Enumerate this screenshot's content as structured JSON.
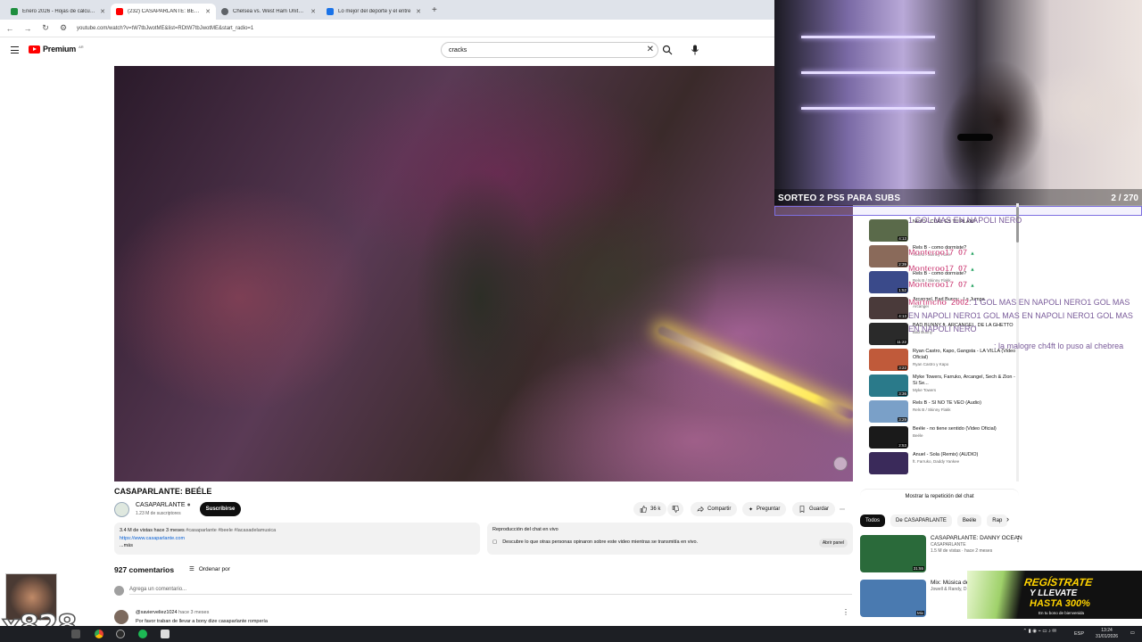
{
  "browser": {
    "tabs": [
      {
        "label": "Enero 2026 - Hojas de cálculo de Google",
        "color": "#1e8e3e"
      },
      {
        "label": "(232) CASAPARLANTE: BEÉLE",
        "color": "#ff0000",
        "active": true
      },
      {
        "label": "Chelsea vs. West Ham United |",
        "color": "#5f6368"
      },
      {
        "label": "Lo mejor del deporte y el entre",
        "color": "#1a73e8"
      }
    ],
    "url": "youtube.com/watch?v=tW7tbJwotME&list=RDtW7tbJwotME&start_radio=1"
  },
  "youtube": {
    "logo": "Premium",
    "logo_country": "AR",
    "search_value": "cracks"
  },
  "overlay": {
    "giveaway_title": "SORTEO 2 PS5 PARA SUBS",
    "giveaway_count": "2",
    "giveaway_total": "/ 270",
    "chat": [
      {
        "user": "",
        "text": "1 GOL MAS EN NAPOLI NERO"
      },
      {
        "user": "Monteroo17_07",
        "text": ""
      },
      {
        "user": "Monteroo17_07",
        "text": ""
      },
      {
        "user": "Monteroo17_07",
        "text": ""
      },
      {
        "user": "Martincho_2002",
        "text": ": 1 GOL MAS EN NAPOLI NERO1 GOL MAS EN NAPOLI NERO1 GOL MAS EN NAPOLI NERO1 GOL MAS EN NAPOLI NERO"
      },
      {
        "user": "",
        "text": ": la malogre ch4ft lo puso al chebrea"
      }
    ],
    "big_number": "x828"
  },
  "playlist": [
    {
      "title": "NEJO - CUAL ES TU PLAN?",
      "channel": "",
      "duration": "4:13",
      "color": "#5a6a4a"
    },
    {
      "title": "Rels B - como dormiste?",
      "channel": "Rels B / Skinny Flakk",
      "duration": "2:39",
      "color": "#8a6a5a"
    },
    {
      "title": "Rels B - como dormiste?",
      "channel": "Rels B / Skinny Flakk",
      "duration": "1:52",
      "color": "#3a4a8a"
    },
    {
      "title": "Arcangel, Bad Bunny - La Jumpa",
      "channel": "Arcangel",
      "duration": "4:13",
      "color": "#4a3a3a"
    },
    {
      "title": "BAD BUNNY ft. ARCANGEL, DE LA GHETTO",
      "channel": "Bad Bunny",
      "duration": "11:22",
      "color": "#2a2a2a"
    },
    {
      "title": "Ryan Castro, Kapo, Gangsta - LA VILLA (Video Oficial)",
      "channel": "Ryan Castro y Kapo",
      "duration": "3:22",
      "color": "#c05a3a"
    },
    {
      "title": "Myke Towers, Farruko, Arcangel, Sech & Zion - Si Se...",
      "channel": "Myke Towers",
      "duration": "3:36",
      "color": "#2a7a8a"
    },
    {
      "title": "Rels B - SI NO TE VEO (Audio)",
      "channel": "Rels B / Skinny Flakk",
      "duration": "3:29",
      "color": "#7aa0c8"
    },
    {
      "title": "Beéle - no tiene sentido (Video Oficial)",
      "channel": "Beéle",
      "duration": "2:53",
      "color": "#1a1a1a"
    },
    {
      "title": "Anuel - Sola (Remix) (AUDIO)",
      "channel": "ft. Farruko, Daddy Yankee",
      "duration": "",
      "color": "#3a2a5a"
    }
  ],
  "video": {
    "title": "CASAPARLANTE: BEÉLE",
    "channel": "CASAPARLANTE",
    "subscribers": "1.23 M de suscriptores",
    "subscribe_label": "Suscribirse",
    "likes": "36 k",
    "share_label": "Compartir",
    "ask_label": "Preguntar",
    "save_label": "Guardar",
    "views_line": "3.4 M de vistas  hace 3 meses",
    "hashtags": "#casaparlante #beele #lacasadelamusica",
    "link": "https://www.casaparlante.com",
    "more": "...más",
    "live_chat_title": "Reproducción del chat en vivo",
    "live_chat_desc": "Descubre lo que otras personas opinaron sobre este video mientras se transmitía en vivo.",
    "open_panel": "Abrir panel"
  },
  "comments": {
    "count": "927 comentarios",
    "sort_label": "Ordenar por",
    "add_placeholder": "Agrega un comentario...",
    "first": {
      "user": "@xavierveliez1024",
      "time": "hace 3 meses",
      "text": "Por favor traban de llevar a bony dize casaparlante rompería"
    }
  },
  "sidebar": {
    "show_chat": "Mostrar la repetición del chat",
    "chips": [
      "Todos",
      "De CASAPARLANTE",
      "Beéle",
      "Rap"
    ],
    "recommended": [
      {
        "title": "CASAPARLANTE: DANNY OCEAN",
        "channel": "CASAPARLANTE",
        "meta": "1.5 M de vistas · hace 2 meses",
        "duration": "31:55",
        "color": "#2a6a3a"
      },
      {
        "title": "Mix: Música de...",
        "channel": "Jowell & Randy, D...",
        "meta": "",
        "duration": "Mix",
        "color": "#4a7ab0"
      }
    ]
  },
  "promo": {
    "line1": "REGÍSTRATE",
    "line2": "Y LLEVATE",
    "line3": "HASTA 300%",
    "line4": "En tu bono de bienvenida"
  },
  "taskbar": {
    "lang": "ESP",
    "time": "13:24",
    "date": "31/01/2026"
  }
}
